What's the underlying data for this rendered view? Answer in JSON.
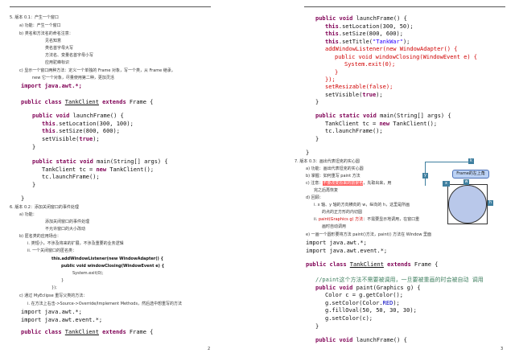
{
  "left": {
    "page_number": "2",
    "lines": [
      [
        {
          "t": "5.   版本 0.1：产生一个窗口"
        }
      ],
      [
        {
          "t": "a)   功能：产生一个窗口"
        }
      ],
      [
        {
          "t": "b)   类名和方法名的命名注意："
        }
      ],
      [
        {
          "t": "见名知意"
        }
      ],
      [
        {
          "t": "类名首字母大写"
        }
      ],
      [
        {
          "t": "方法名、变量名首字母小写"
        }
      ],
      [
        {
          "t": "应用驼峰标识"
        }
      ],
      [
        {
          "t": "c)   显示一个窗口两种方法：定义一个单独的 Frame 对象，写一个类，从 Frame 继承，"
        }
      ],
      [
        {
          "t": "new 它一个对象，尽量使用第二种，更加灵活"
        }
      ],
      [
        {
          "t": "import java.awt.*;",
          "s": "kw0"
        }
      ],
      [
        {
          "t": "public class ",
          "s": "kw"
        },
        {
          "t": "TankClient",
          "s": "ul"
        },
        {
          "t": " extends ",
          "s": "kw"
        },
        {
          "t": "Frame {"
        }
      ],
      [
        {
          "t": "public void ",
          "s": "kw"
        },
        {
          "t": "launchFrame() {"
        }
      ],
      [
        {
          "t": "this",
          "s": "kw"
        },
        {
          "t": ".setLocation(300, 100);"
        }
      ],
      [
        {
          "t": "this",
          "s": "kw"
        },
        {
          "t": ".setSize(800, 600);"
        }
      ],
      [
        {
          "t": "setVisible("
        },
        {
          "t": "true",
          "s": "kw"
        },
        {
          "t": ");"
        }
      ],
      [
        {
          "t": "}"
        }
      ],
      [
        {
          "t": "public static void ",
          "s": "kw"
        },
        {
          "t": "main(String[] args) {"
        }
      ],
      [
        {
          "t": "TankClient tc = "
        },
        {
          "t": "new ",
          "s": "kw"
        },
        {
          "t": "TankClient();"
        }
      ],
      [
        {
          "t": "tc.launchFrame();"
        }
      ],
      [
        {
          "t": "}"
        }
      ],
      [
        {
          "t": "}"
        }
      ],
      [
        {
          "t": "6.   版本 0.2：添加关闭窗口的事件处理"
        }
      ],
      [
        {
          "t": "a)   功能："
        }
      ],
      [
        {
          "t": "添加关闭窗口的事件处理"
        }
      ],
      [
        {
          "t": "不允许窗口的大小改动"
        }
      ],
      [
        {
          "t": "b)   匿名类的应用场合："
        }
      ],
      [
        {
          "t": "i.    类短小，不涉及将来的扩展，不涉及重要的业务逻辑"
        }
      ],
      [
        {
          "t": "ii.    一个关闭窗口的匿名类："
        }
      ],
      [
        {
          "t": "this.addWindowListener(new WindowAdapter() {"
        }
      ],
      [
        {
          "t": "public void windowClosing(WindowEvent e) {"
        }
      ],
      [
        {
          "t": "System.exit(0);"
        }
      ],
      [
        {
          "t": "}"
        }
      ],
      [
        {
          "t": "});"
        }
      ],
      [
        {
          "t": "c)   通过 MyEclipse 重写父类的方法："
        }
      ],
      [
        {
          "t": "i.    在方法上右击->Source->Override/Implement Methods，然后选中想重写的方法"
        }
      ],
      [
        {
          "t": "import java.awt.*;"
        }
      ],
      [
        {
          "t": "import java.awt.event.*;"
        }
      ],
      [
        {
          "t": "public class ",
          "s": "kw"
        },
        {
          "t": "TankClient",
          "s": "ul"
        },
        {
          "t": " extends ",
          "s": "kw"
        },
        {
          "t": "Frame {"
        }
      ]
    ]
  },
  "right": {
    "page_number": "3",
    "lines": [
      [
        {
          "t": "public void ",
          "s": "kw"
        },
        {
          "t": "launchFrame() {"
        }
      ],
      [
        {
          "t": "this",
          "s": "kw"
        },
        {
          "t": ".setLocation(300, 50);"
        }
      ],
      [
        {
          "t": "this",
          "s": "kw"
        },
        {
          "t": ".setSize(800, 600);"
        }
      ],
      [
        {
          "t": "this",
          "s": "kw"
        },
        {
          "t": ".setTitle("
        },
        {
          "t": "\"TankWar\"",
          "s": "str"
        },
        {
          "t": ");"
        }
      ],
      [
        {
          "t": "addWindowListener(new WindowAdapter() {",
          "s": "red"
        }
      ],
      [
        {
          "t": "public void windowClosing(WindowEvent e) {",
          "s": "red"
        }
      ],
      [
        {
          "t": "System.exit(0);",
          "s": "red"
        }
      ],
      [
        {
          "t": "}",
          "s": "red"
        }
      ],
      [
        {
          "t": "});",
          "s": "red"
        }
      ],
      [
        {
          "t": "setResizable(false);",
          "s": "red"
        }
      ],
      [
        {
          "t": "setVisible("
        },
        {
          "t": "true",
          "s": "kw"
        },
        {
          "t": ");"
        }
      ],
      [
        {
          "t": "}"
        }
      ],
      [
        {
          "t": "public static void ",
          "s": "kw"
        },
        {
          "t": "main(String[] args) {"
        }
      ],
      [
        {
          "t": "TankClient tc = "
        },
        {
          "t": "new ",
          "s": "kw"
        },
        {
          "t": "TankClient();"
        }
      ],
      [
        {
          "t": "tc.launchFrame();"
        }
      ],
      [
        {
          "t": "}"
        }
      ],
      [
        {
          "t": "}"
        }
      ],
      [
        {
          "t": "7.   版本 0.3：画出代表坦克的实心圆"
        }
      ],
      [
        {
          "t": "a)   功能：画出代表坦克的实心圆"
        }
      ],
      [
        {
          "t": "b)   掌握：如何重写 paint 方法"
        }
      ],
      [
        {
          "t": "c)   注意："
        },
        {
          "t": "不要改变原来的前景色",
          "s": "hlred"
        },
        {
          "t": "，先取出来，用"
        }
      ],
      [
        {
          "t": "完之后再恢复"
        }
      ],
      [
        {
          "t": "d)   回顾："
        }
      ],
      [
        {
          "t": "i.    x 轴、y 轴的方向横向的 w，纵向的 h，这里是所画"
        }
      ],
      [
        {
          "t": "的点的正方形的内切圆"
        }
      ],
      [
        {
          "t": "ii.   "
        },
        {
          "t": "paint(Graphics g)",
          "s": "hlpurple"
        },
        {
          "t": " 方法",
          "s": "hlred2"
        },
        {
          "t": "：不需要显示地调用，在窗口重"
        }
      ],
      [
        {
          "t": "画时自动调用"
        }
      ],
      [
        {
          "t": "e)   一画一个圆形要将方法 paint()方法，paint() 方法在 Window 里面"
        }
      ],
      [
        {
          "t": "import java.awt.*;"
        }
      ],
      [
        {
          "t": "import java.awt.event.*;"
        }
      ],
      [
        {
          "t": "public class ",
          "s": "kw"
        },
        {
          "t": "TankClient",
          "s": "ul"
        },
        {
          "t": " extends ",
          "s": "kw"
        },
        {
          "t": "Frame {"
        }
      ],
      [
        {
          "t": "//paint这个方法不需要被调用，一旦要被重画的时会被自动 调用",
          "s": "cmt"
        }
      ],
      [
        {
          "t": "public void ",
          "s": "kw"
        },
        {
          "t": "paint(Graphics g) {"
        }
      ],
      [
        {
          "t": "Color c = g.getColor();"
        }
      ],
      [
        {
          "t": "g.setColor(Color."
        },
        {
          "t": "RED",
          "s": "fld"
        },
        {
          "t": ");"
        }
      ],
      [
        {
          "t": "g.fillOval(50, 50, 30, 30);"
        }
      ],
      [
        {
          "t": "g.setColor(c);"
        }
      ],
      [
        {
          "t": "}"
        }
      ],
      [
        {
          "t": "public void ",
          "s": "kw"
        },
        {
          "t": "launchFrame() {"
        }
      ]
    ],
    "diagram": {
      "callout": "Frame的左上角",
      "tag_k": "k",
      "tag_y": "y",
      "tag_x": "x",
      "tag_w": "w",
      "tag_h": "h"
    }
  }
}
